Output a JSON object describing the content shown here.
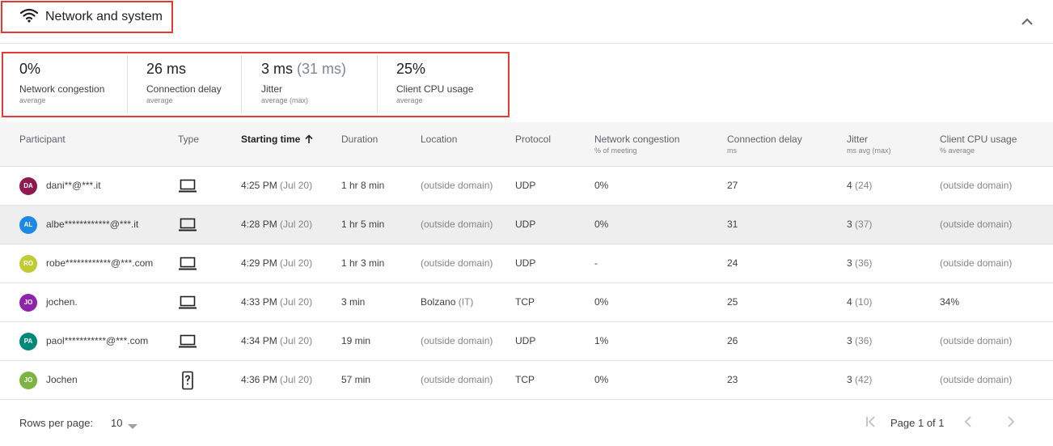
{
  "section": {
    "title": "Network and system",
    "icon": "wifi-icon"
  },
  "stats": [
    {
      "value": "0%",
      "extra": "",
      "label": "Network congestion",
      "agg": "average"
    },
    {
      "value": "26 ms",
      "extra": "",
      "label": "Connection delay",
      "agg": "average"
    },
    {
      "value": "3 ms",
      "extra": "(31 ms)",
      "label": "Jitter",
      "agg": "average (max)"
    },
    {
      "value": "25%",
      "extra": "",
      "label": "Client CPU usage",
      "agg": "average"
    }
  ],
  "table": {
    "columns": [
      {
        "label": "Participant",
        "unit": ""
      },
      {
        "label": "Type",
        "unit": ""
      },
      {
        "label": "Starting time",
        "unit": "",
        "sorted": "ascending"
      },
      {
        "label": "Duration",
        "unit": ""
      },
      {
        "label": "Location",
        "unit": ""
      },
      {
        "label": "Protocol",
        "unit": ""
      },
      {
        "label": "Network congestion",
        "unit": "% of meeting"
      },
      {
        "label": "Connection delay",
        "unit": "ms"
      },
      {
        "label": "Jitter",
        "unit": "ms avg (max)"
      },
      {
        "label": "Client CPU usage",
        "unit": "% average"
      }
    ],
    "rows": [
      {
        "initials": "DA",
        "avatar_color": "#8e1a4f",
        "name": "dani**@***.it",
        "device": "laptop-icon",
        "time": "4:25 PM",
        "date": "(Jul 20)",
        "duration": "1 hr 8 min",
        "location": "(outside domain)",
        "location_extra": "",
        "protocol": "UDP",
        "congestion": "0%",
        "delay": "27",
        "jitter": "4",
        "jitter_max": "(24)",
        "cpu": "(outside domain)"
      },
      {
        "initials": "AL",
        "avatar_color": "#1e88e5",
        "name": "albe************@***.it",
        "device": "laptop-icon",
        "time": "4:28 PM",
        "date": "(Jul 20)",
        "duration": "1 hr 5 min",
        "location": "(outside domain)",
        "location_extra": "",
        "protocol": "UDP",
        "congestion": "0%",
        "delay": "31",
        "jitter": "3",
        "jitter_max": "(37)",
        "cpu": "(outside domain)"
      },
      {
        "initials": "RO",
        "avatar_color": "#c0ca33",
        "name": "robe************@***.com",
        "device": "laptop-icon",
        "time": "4:29 PM",
        "date": "(Jul 20)",
        "duration": "1 hr 3 min",
        "location": "(outside domain)",
        "location_extra": "",
        "protocol": "UDP",
        "congestion": "-",
        "delay": "24",
        "jitter": "3",
        "jitter_max": "(36)",
        "cpu": "(outside domain)"
      },
      {
        "initials": "JO",
        "avatar_color": "#8e24aa",
        "name": "jochen.",
        "device": "laptop-icon",
        "time": "4:33 PM",
        "date": "(Jul 20)",
        "duration": "3 min",
        "location": "Bolzano",
        "location_extra": "(IT)",
        "protocol": "TCP",
        "congestion": "0%",
        "delay": "25",
        "jitter": "4",
        "jitter_max": "(10)",
        "cpu": "34%"
      },
      {
        "initials": "PA",
        "avatar_color": "#00897b",
        "name": "paol***********@***.com",
        "device": "laptop-icon",
        "time": "4:34 PM",
        "date": "(Jul 20)",
        "duration": "19 min",
        "location": "(outside domain)",
        "location_extra": "",
        "protocol": "UDP",
        "congestion": "1%",
        "delay": "26",
        "jitter": "3",
        "jitter_max": "(36)",
        "cpu": "(outside domain)"
      },
      {
        "initials": "JO",
        "avatar_color": "#7cb342",
        "name": "Jochen",
        "device": "unknown-device-icon",
        "time": "4:36 PM",
        "date": "(Jul 20)",
        "duration": "57 min",
        "location": "(outside domain)",
        "location_extra": "",
        "protocol": "TCP",
        "congestion": "0%",
        "delay": "23",
        "jitter": "3",
        "jitter_max": "(42)",
        "cpu": "(outside domain)"
      }
    ]
  },
  "footer": {
    "rows_per_page_label": "Rows per page:",
    "rows_per_page_value": "10",
    "page_label": "Page 1 of 1"
  }
}
